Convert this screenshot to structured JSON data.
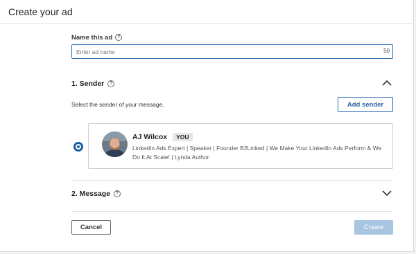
{
  "header": {
    "title": "Create your ad"
  },
  "name_field": {
    "label": "Name this ad",
    "placeholder": "Enter ad name",
    "value": "",
    "char_remaining": "50"
  },
  "sender_section": {
    "title": "1.  Sender",
    "description": "Select the sender of your message.",
    "add_sender_label": "Add sender",
    "expanded": true,
    "selected_sender": {
      "name": "AJ Wilcox",
      "badge": "YOU",
      "bio": "LinkedIn Ads Expert | Speaker | Founder B2Linked | We Make Your LinkedIn Ads Perform & We Do It At Scale! | Lynda Author"
    }
  },
  "message_section": {
    "title": "2.  Message",
    "expanded": false
  },
  "footer": {
    "cancel_label": "Cancel",
    "create_label": "Create"
  },
  "colors": {
    "accent": "#2f6db5",
    "radio": "#1b5ea5",
    "create_disabled": "#a7c4e1"
  }
}
